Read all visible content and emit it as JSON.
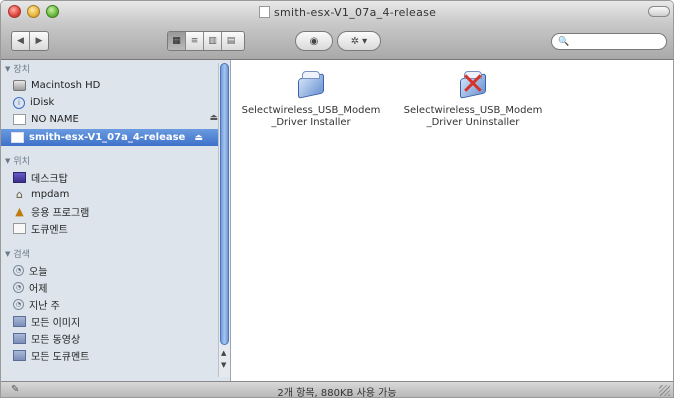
{
  "window": {
    "title": "smith-esx-V1_07a_4-release"
  },
  "toolbar": {
    "back_icon": "◀",
    "forward_icon": "▶",
    "view_icons": [
      "▦",
      "≡",
      "▥",
      "▤"
    ],
    "eye_icon": "◉",
    "action_icon": "✲",
    "action_caret": "▾",
    "search_icon": "🔍",
    "search_placeholder": ""
  },
  "sidebar": {
    "devices_header": "장치",
    "devices": [
      {
        "label": "Macintosh HD",
        "icon": "hard-disk-icon"
      },
      {
        "label": "iDisk",
        "icon": "idisk-icon"
      },
      {
        "label": "NO NAME",
        "icon": "blank-disk-icon",
        "eject": "⏏"
      },
      {
        "label": "smith-esx-V1_07a_4-release",
        "icon": "disk-image-icon",
        "eject": "⏏",
        "selected": true
      }
    ],
    "places_header": "위치",
    "places": [
      {
        "label": "데스크탑",
        "icon": "desktop-icon"
      },
      {
        "label": "mpdam",
        "icon": "home-icon"
      },
      {
        "label": "응용 프로그램",
        "icon": "applications-icon"
      },
      {
        "label": "도큐멘트",
        "icon": "documents-icon"
      }
    ],
    "search_header": "검색",
    "search_for": [
      {
        "label": "오늘",
        "icon": "clock-icon"
      },
      {
        "label": "어제",
        "icon": "clock-icon"
      },
      {
        "label": "지난 주",
        "icon": "clock-icon"
      },
      {
        "label": "모든 이미지",
        "icon": "smart-folder-icon"
      },
      {
        "label": "모든 동영상",
        "icon": "smart-folder-icon"
      },
      {
        "label": "모든 도큐멘트",
        "icon": "smart-folder-icon"
      }
    ]
  },
  "files": [
    {
      "label_line1": "Selectwireless_USB_Modem",
      "label_line2": "_Driver Installer",
      "icon": "installer-package-icon"
    },
    {
      "label_line1": "Selectwireless_USB_Modem",
      "label_line2": "_Driver Uninstaller",
      "icon": "uninstaller-package-icon"
    }
  ],
  "status": {
    "text": "2개 항목, 880KB 사용 가능"
  },
  "colors": {
    "sidebar_bg": "#dde4ec",
    "selection": "#3e71c9"
  }
}
